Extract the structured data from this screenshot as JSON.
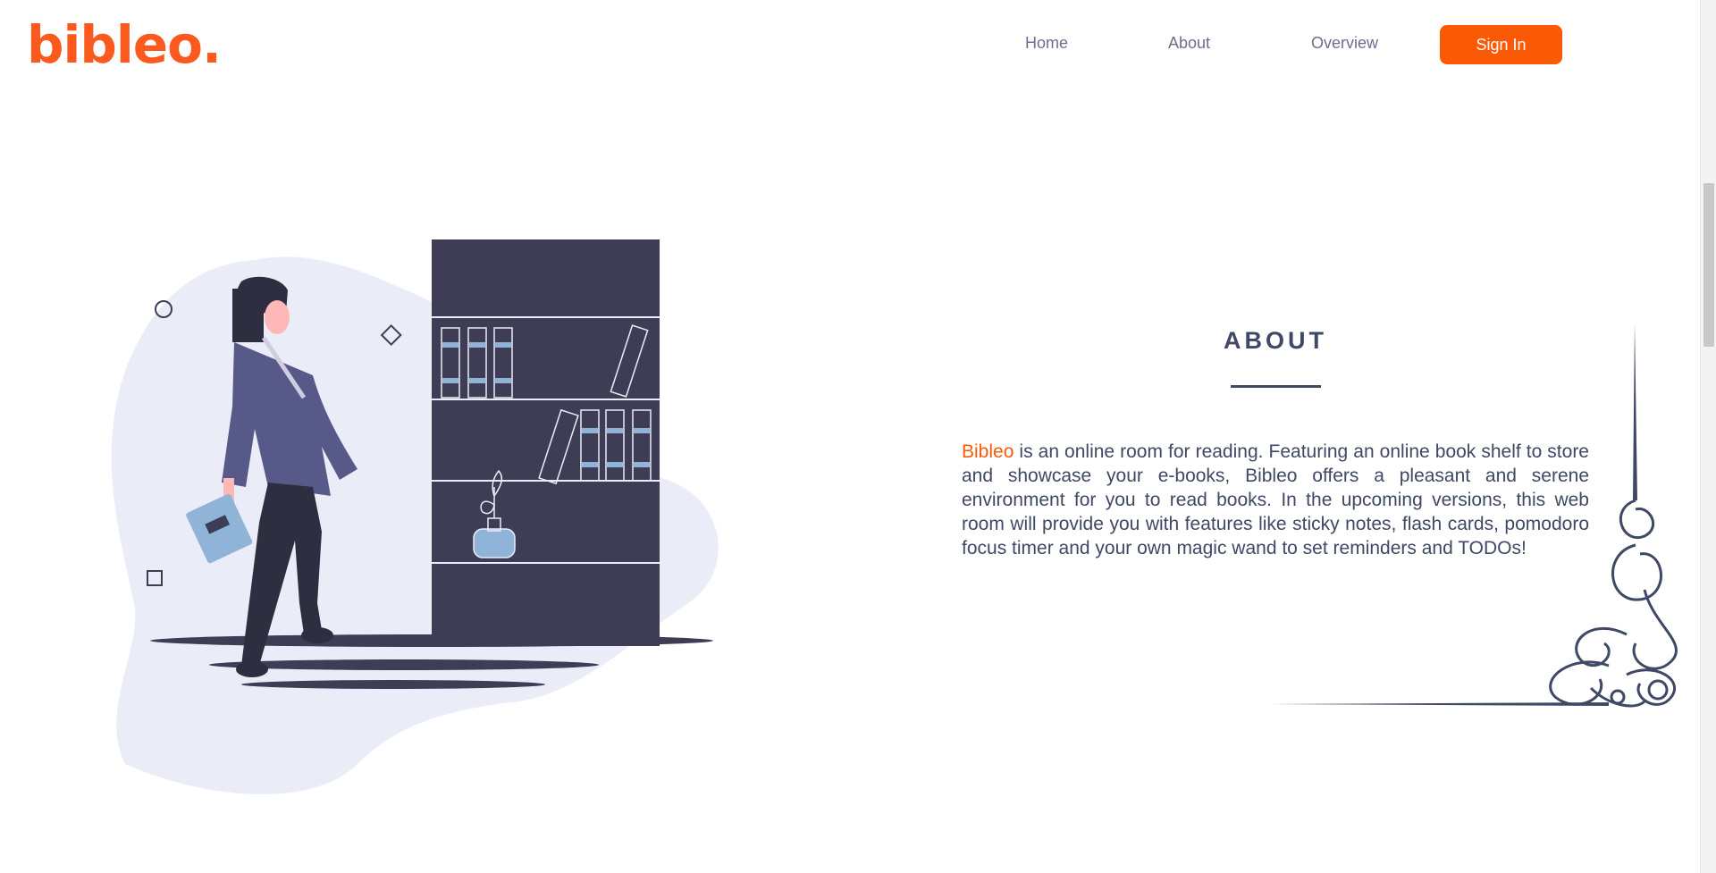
{
  "brand": {
    "logo_text": "bibleo.",
    "logo_color": "#fa5a1e"
  },
  "nav": {
    "links": [
      {
        "label": "Home"
      },
      {
        "label": "About"
      },
      {
        "label": "Overview"
      }
    ],
    "signin_label": "Sign In",
    "signin_color": "#fa5a06"
  },
  "about": {
    "heading": "ABOUT",
    "brand_word": "Bibleo",
    "body": " is an online room for reading. Featuring an online book shelf to store and showcase your e-books, Bibleo offers a pleasant and serene environment for you to read books. In the upcoming versions, this web room will provide you with features like sticky notes, flash cards, pomodoro focus timer and your own magic wand to set reminders and TODOs!",
    "text_color": "#3f4865"
  },
  "illustration": {
    "subject": "woman-standing-by-bookshelf",
    "colors": {
      "blob": "#eaedf7",
      "shelf": "#3f3d56",
      "jacket": "#575a89",
      "book": "#8fb4d8"
    }
  }
}
